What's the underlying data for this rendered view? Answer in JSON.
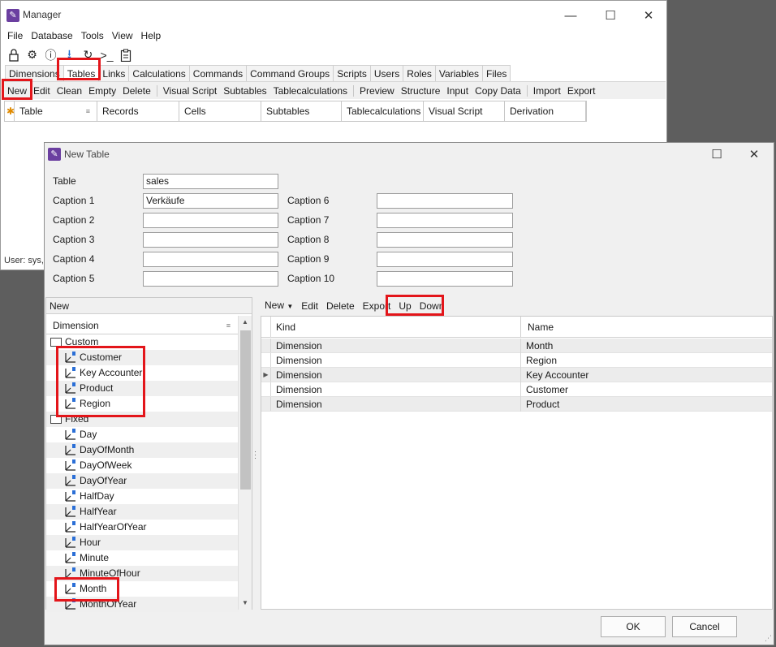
{
  "manager": {
    "title": "Manager",
    "menu": [
      "File",
      "Database",
      "Tools",
      "View",
      "Help"
    ],
    "tabs": [
      "Dimensions",
      "Tables",
      "Links",
      "Calculations",
      "Commands",
      "Command Groups",
      "Scripts",
      "Users",
      "Roles",
      "Variables",
      "Files"
    ],
    "toolbar": [
      "New",
      "Edit",
      "Clean",
      "Empty",
      "Delete",
      "Visual Script",
      "Subtables",
      "Tablecalculations",
      "Preview",
      "Structure",
      "Input",
      "Copy Data",
      "Import",
      "Export"
    ],
    "columns": [
      "Table",
      "Records",
      "Cells",
      "Subtables",
      "Tablecalculations",
      "Visual Script",
      "Derivation"
    ],
    "status": "User: sys,",
    "icons": [
      "lock-icon",
      "gear-icon",
      "info-icon",
      "download-icon",
      "redo-icon",
      "terminal-icon",
      "clipboard-icon"
    ]
  },
  "dialog": {
    "title": "New Table",
    "table_label": "Table",
    "table_value": "sales",
    "captions_left": [
      {
        "label": "Caption 1",
        "value": "Verkäufe"
      },
      {
        "label": "Caption 2",
        "value": ""
      },
      {
        "label": "Caption 3",
        "value": ""
      },
      {
        "label": "Caption 4",
        "value": ""
      },
      {
        "label": "Caption 5",
        "value": ""
      }
    ],
    "captions_right": [
      {
        "label": "Caption 6",
        "value": ""
      },
      {
        "label": "Caption 7",
        "value": ""
      },
      {
        "label": "Caption 8",
        "value": ""
      },
      {
        "label": "Caption 9",
        "value": ""
      },
      {
        "label": "Caption 10",
        "value": ""
      }
    ],
    "left_panel": {
      "header": "New",
      "column": "Dimension",
      "tree": [
        {
          "label": "Custom",
          "kind": "folder"
        },
        {
          "label": "Customer",
          "kind": "dim"
        },
        {
          "label": "Key Accounter",
          "kind": "dim"
        },
        {
          "label": "Product",
          "kind": "dim"
        },
        {
          "label": "Region",
          "kind": "dim"
        },
        {
          "label": "Fixed",
          "kind": "folder"
        },
        {
          "label": "Day",
          "kind": "dim"
        },
        {
          "label": "DayOfMonth",
          "kind": "dim"
        },
        {
          "label": "DayOfWeek",
          "kind": "dim"
        },
        {
          "label": "DayOfYear",
          "kind": "dim"
        },
        {
          "label": "HalfDay",
          "kind": "dim"
        },
        {
          "label": "HalfYear",
          "kind": "dim"
        },
        {
          "label": "HalfYearOfYear",
          "kind": "dim"
        },
        {
          "label": "Hour",
          "kind": "dim"
        },
        {
          "label": "Minute",
          "kind": "dim"
        },
        {
          "label": "MinuteOfHour",
          "kind": "dim"
        },
        {
          "label": "Month",
          "kind": "dim"
        },
        {
          "label": "MonthOfYear",
          "kind": "dim"
        }
      ]
    },
    "right_toolbar": [
      "New",
      "Edit",
      "Delete",
      "Export",
      "Up",
      "Down"
    ],
    "right_columns": [
      "Kind",
      "Name"
    ],
    "rows": [
      {
        "kind": "Dimension",
        "name": "Month"
      },
      {
        "kind": "Dimension",
        "name": "Region"
      },
      {
        "kind": "Dimension",
        "name": "Key Accounter"
      },
      {
        "kind": "Dimension",
        "name": "Customer"
      },
      {
        "kind": "Dimension",
        "name": "Product"
      }
    ],
    "ok": "OK",
    "cancel": "Cancel"
  },
  "colors": {
    "highlight": "#e3151a",
    "app_icon": "#6b3fa0",
    "desktop": "#5e5e5e"
  }
}
